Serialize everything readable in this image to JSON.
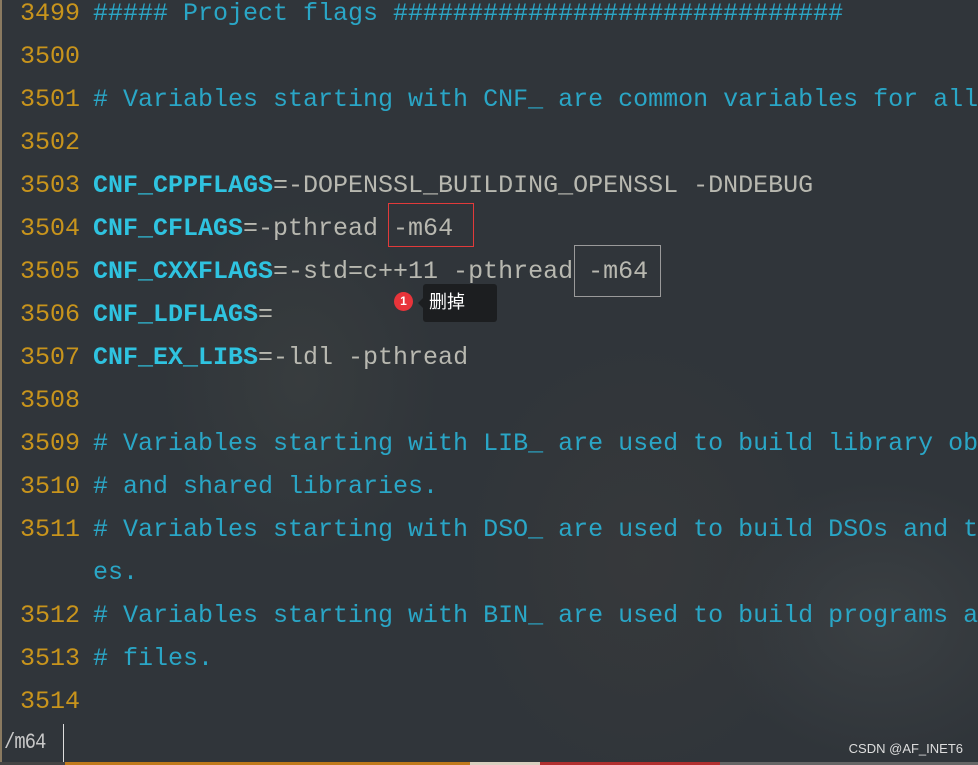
{
  "editor": {
    "lines": [
      {
        "num": "3499",
        "parts": [
          {
            "t": "##### Project flags ##############################",
            "c": "cmt"
          }
        ]
      },
      {
        "num": "3500",
        "parts": []
      },
      {
        "num": "3501",
        "parts": [
          {
            "t": "# Variables starting with CNF_ are common variables for all",
            "c": "cmt"
          }
        ]
      },
      {
        "num": "3502",
        "parts": []
      },
      {
        "num": "3503",
        "parts": [
          {
            "t": "CNF_CPPFLAGS",
            "c": "kw"
          },
          {
            "t": "=-DOPENSSL_BUILDING_OPENSSL -DNDEBUG",
            "c": "val"
          }
        ]
      },
      {
        "num": "3504",
        "parts": [
          {
            "t": "CNF_CFLAGS",
            "c": "kw"
          },
          {
            "t": "=-pthread -m64",
            "c": "val"
          }
        ]
      },
      {
        "num": "3505",
        "parts": [
          {
            "t": "CNF_CXXFLAGS",
            "c": "kw"
          },
          {
            "t": "=-std=c++11 -pthread -m64",
            "c": "val"
          }
        ]
      },
      {
        "num": "3506",
        "parts": [
          {
            "t": "CNF_LDFLAGS",
            "c": "kw"
          },
          {
            "t": "=",
            "c": "val"
          }
        ]
      },
      {
        "num": "3507",
        "parts": [
          {
            "t": "CNF_EX_LIBS",
            "c": "kw"
          },
          {
            "t": "=-ldl -pthread",
            "c": "val"
          }
        ]
      },
      {
        "num": "3508",
        "parts": []
      },
      {
        "num": "3509",
        "parts": [
          {
            "t": "# Variables starting with LIB_ are used to build library ob",
            "c": "cmt"
          }
        ]
      },
      {
        "num": "3510",
        "parts": [
          {
            "t": "# and shared libraries.",
            "c": "cmt"
          }
        ]
      },
      {
        "num": "3511",
        "parts": [
          {
            "t": "# Variables starting with DSO_ are used to build DSOs and t",
            "c": "cmt"
          }
        ]
      },
      {
        "num": "",
        "parts": [
          {
            "t": "es.",
            "c": "cmt"
          }
        ]
      },
      {
        "num": "3512",
        "parts": [
          {
            "t": "# Variables starting with BIN_ are used to build programs a",
            "c": "cmt"
          }
        ]
      },
      {
        "num": "3513",
        "parts": [
          {
            "t": "# files.",
            "c": "cmt"
          }
        ]
      },
      {
        "num": "3514",
        "parts": []
      }
    ]
  },
  "annotation": {
    "badge": "1",
    "label": "删掉"
  },
  "command_line": "/m64",
  "watermark": "CSDN @AF_INET6",
  "colors": {
    "line_number": "#c8941c",
    "comment": "#2aa6c6",
    "keyword": "#2fc3e0",
    "highlight_box": "#e23a3a"
  }
}
